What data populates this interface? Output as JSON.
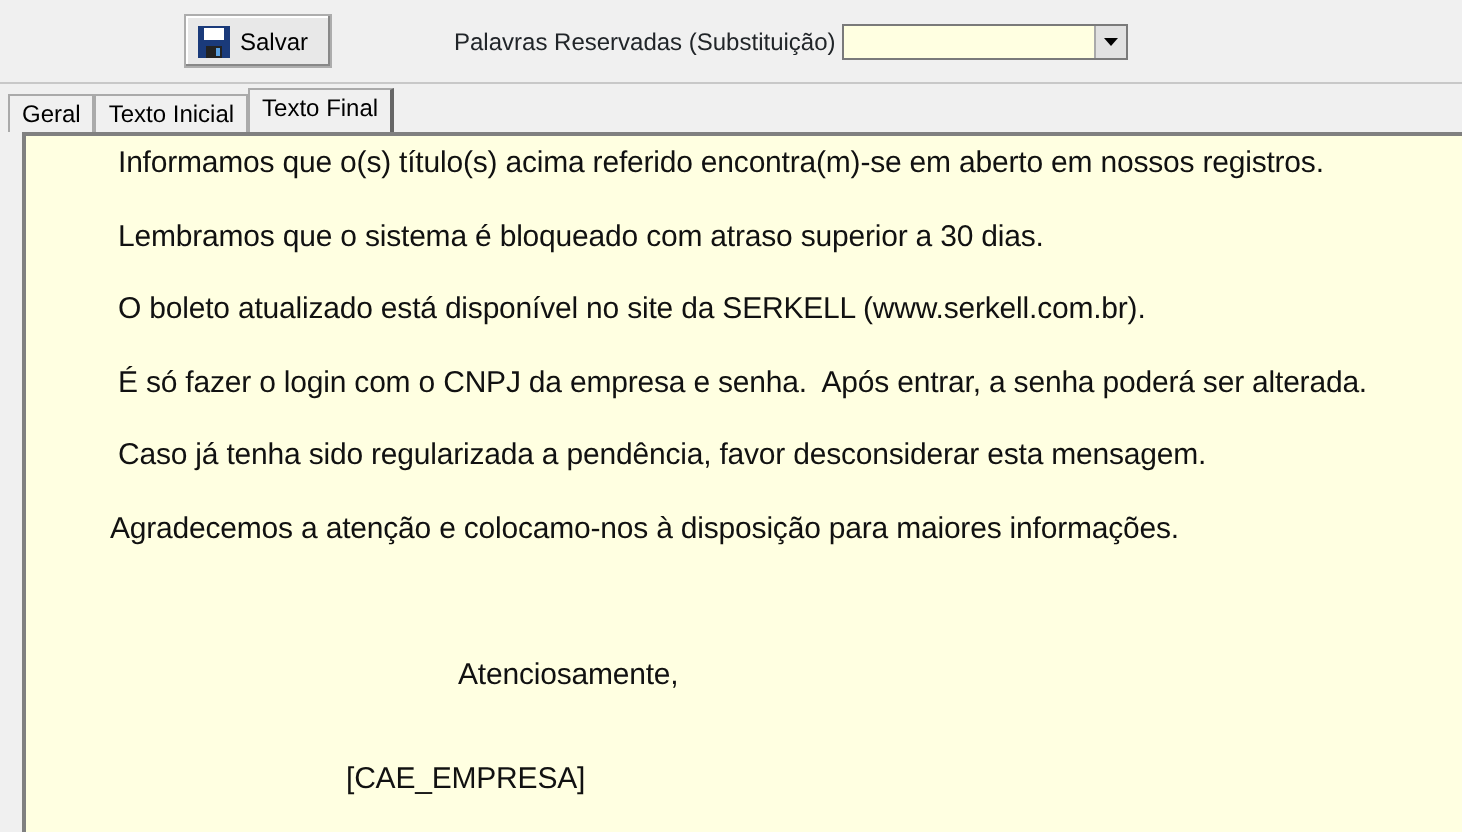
{
  "toolbar": {
    "save_button": "Salvar",
    "reserved_words_label": "Palavras Reservadas (Substituição)"
  },
  "tabs": [
    {
      "label": "Geral",
      "selected": false
    },
    {
      "label": "Texto Inicial",
      "selected": false
    },
    {
      "label": "Texto Final",
      "selected": true
    }
  ],
  "memo": [
    {
      "kind": "paragraph",
      "text": "Informamos que o(s) título(s) acima referido encontra(m)-se em aberto em nossos registros."
    },
    {
      "kind": "paragraph",
      "text": "Lembramos que o sistema é bloqueado com atraso superior a 30 dias."
    },
    {
      "kind": "paragraph",
      "text": "O boleto atualizado está disponível no site da SERKELL (www.serkell.com.br)."
    },
    {
      "kind": "paragraph",
      "text": "É só fazer o login com o CNPJ da empresa e senha.  Após entrar, a senha poderá ser alterada."
    },
    {
      "kind": "paragraph",
      "text": "Caso já tenha sido regularizada a pendência, favor desconsiderar esta mensagem."
    },
    {
      "kind": "outdent",
      "text": "Agradecemos a atenção e colocamo-nos à disposição para maiores informações."
    },
    {
      "kind": "blank"
    },
    {
      "kind": "closing",
      "text": "Atenciosamente,"
    },
    {
      "kind": "signature",
      "text": "[CAE_EMPRESA]"
    }
  ]
}
